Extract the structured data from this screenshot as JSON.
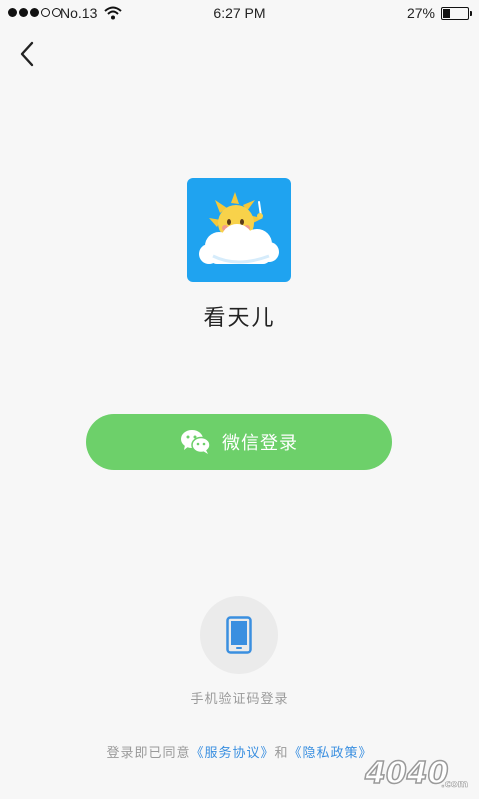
{
  "status_bar": {
    "carrier": "No.13",
    "time": "6:27 PM",
    "battery_percent": "27%",
    "battery_level": 0.27,
    "signal_bars_filled": 3,
    "signal_bars_total": 5
  },
  "header": {
    "back_icon": "chevron-left-icon"
  },
  "app": {
    "name": "看天儿",
    "icon": "sun-cloud-app-icon"
  },
  "wechat_login": {
    "label": "微信登录",
    "icon": "wechat-icon",
    "color": "#6dd06a"
  },
  "phone_login": {
    "label": "手机验证码登录",
    "icon": "phone-icon",
    "accent": "#3a8fe0"
  },
  "agreement": {
    "prefix": "登录即已同意",
    "service_link": "《服务协议》",
    "conjunction": "和",
    "privacy_link": "《隐私政策》"
  },
  "watermark": {
    "text": "4040",
    "suffix": ".com"
  }
}
